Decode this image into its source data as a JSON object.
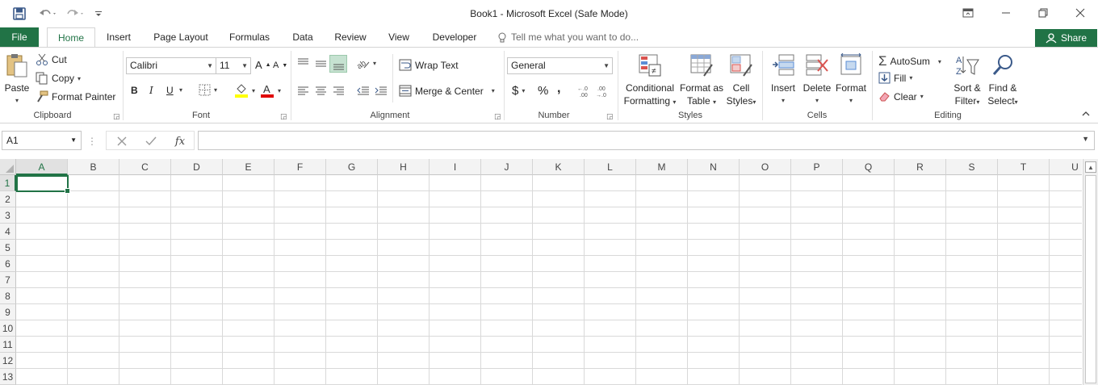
{
  "app": {
    "title": "Book1 - Microsoft Excel (Safe Mode)"
  },
  "colors": {
    "accent": "#217346",
    "font_color_swatch": "#e00000",
    "fill_color_swatch": "#ffff00"
  },
  "qat": {
    "save_icon": "save-icon",
    "undo_icon": "undo-icon",
    "redo_icon": "redo-icon",
    "customize_icon": "customize-qat-icon"
  },
  "tabs": [
    {
      "label": "File"
    },
    {
      "label": "Home"
    },
    {
      "label": "Insert"
    },
    {
      "label": "Page Layout"
    },
    {
      "label": "Formulas"
    },
    {
      "label": "Data"
    },
    {
      "label": "Review"
    },
    {
      "label": "View"
    },
    {
      "label": "Developer"
    }
  ],
  "tell_me": "Tell me what you want to do...",
  "share": "Share",
  "ribbon": {
    "clipboard": {
      "label": "Clipboard",
      "paste": "Paste",
      "cut": "Cut",
      "copy": "Copy",
      "format_painter": "Format Painter"
    },
    "font": {
      "label": "Font",
      "font_name": "Calibri",
      "font_size": "11",
      "bold": "B",
      "italic": "I",
      "underline": "U"
    },
    "alignment": {
      "label": "Alignment",
      "wrap_text": "Wrap Text",
      "merge_center": "Merge & Center"
    },
    "number": {
      "label": "Number",
      "format": "General",
      "currency": "$",
      "percent": "%",
      "comma": ","
    },
    "styles": {
      "label": "Styles",
      "conditional_formatting_1": "Conditional",
      "conditional_formatting_2": "Formatting",
      "format_as_table_1": "Format as",
      "format_as_table_2": "Table",
      "cell_styles_1": "Cell",
      "cell_styles_2": "Styles"
    },
    "cells": {
      "label": "Cells",
      "insert": "Insert",
      "delete": "Delete",
      "format": "Format"
    },
    "editing": {
      "label": "Editing",
      "autosum": "AutoSum",
      "fill": "Fill",
      "clear": "Clear",
      "sort_filter_1": "Sort &",
      "sort_filter_2": "Filter",
      "find_select_1": "Find &",
      "find_select_2": "Select"
    }
  },
  "formula_bar": {
    "name_box": "A1",
    "fx": "fx",
    "value": ""
  },
  "grid": {
    "columns": [
      "A",
      "B",
      "C",
      "D",
      "E",
      "F",
      "G",
      "H",
      "I",
      "J",
      "K",
      "L",
      "M",
      "N",
      "O",
      "P",
      "Q",
      "R",
      "S",
      "T",
      "U"
    ],
    "rows": [
      "1",
      "2",
      "3",
      "4",
      "5",
      "6",
      "7",
      "8",
      "9",
      "10",
      "11",
      "12",
      "13"
    ],
    "selected_cell": "A1"
  }
}
